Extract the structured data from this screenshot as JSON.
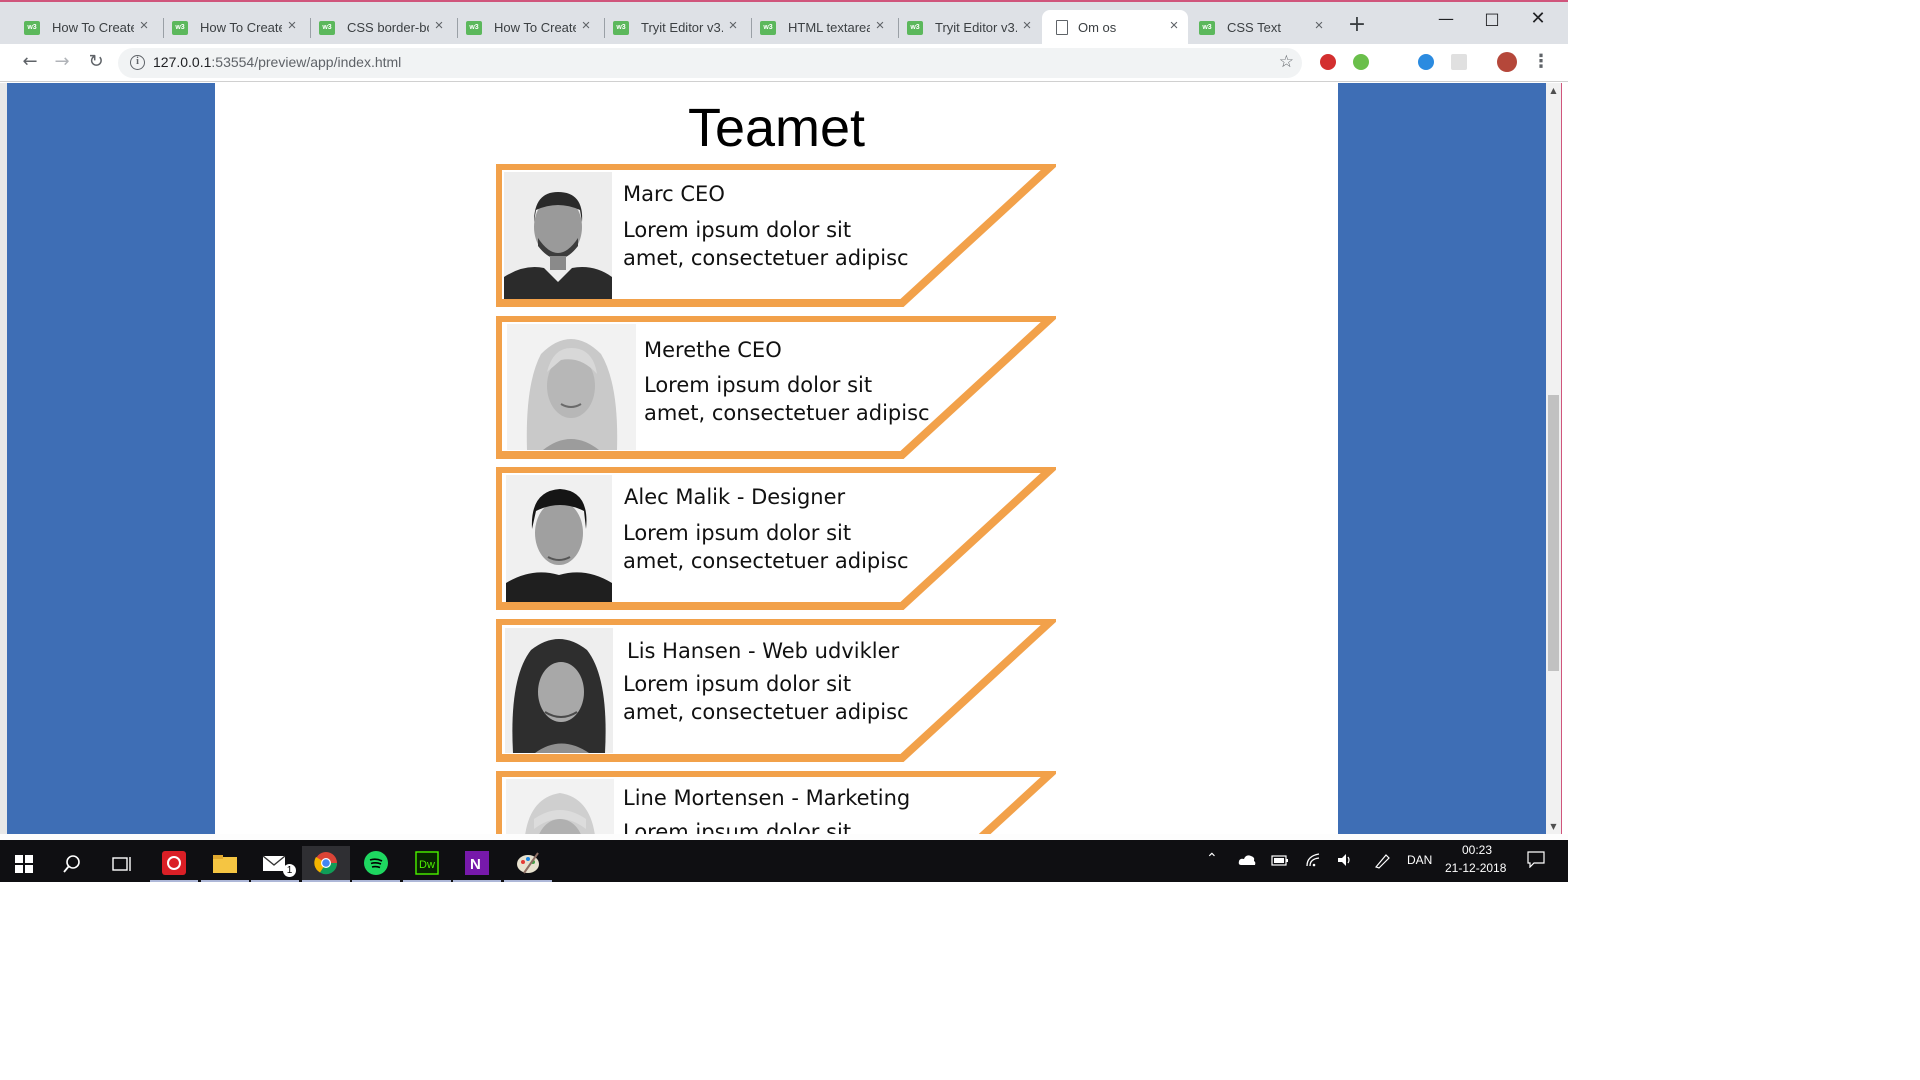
{
  "browser": {
    "tabs": [
      {
        "title": "How To Create",
        "icon": "w3-icon"
      },
      {
        "title": "How To Create",
        "icon": "w3-icon"
      },
      {
        "title": "CSS border-bo",
        "icon": "w3-icon"
      },
      {
        "title": "How To Create",
        "icon": "w3-icon"
      },
      {
        "title": "Tryit Editor v3.",
        "icon": "w3-icon"
      },
      {
        "title": "HTML textarea",
        "icon": "w3-icon"
      },
      {
        "title": "Tryit Editor v3.",
        "icon": "w3-icon"
      },
      {
        "title": "Om os",
        "icon": "document-icon",
        "active": true
      },
      {
        "title": "CSS Text",
        "icon": "w3-icon"
      }
    ],
    "url_host": "127.0.0.1",
    "url_rest": ":53554/preview/app/index.html"
  },
  "page": {
    "title": "Teamet",
    "members": [
      {
        "name": "Marc CEO",
        "desc_line1": "Lorem ipsum dolor sit",
        "desc_line2": "amet, consectetuer adipisc"
      },
      {
        "name": "Merethe CEO",
        "desc_line1": "Lorem ipsum dolor sit",
        "desc_line2": "amet, consectetuer adipisc"
      },
      {
        "name": "Alec Malik - Designer",
        "desc_line1": "Lorem ipsum dolor sit",
        "desc_line2": "amet, consectetuer adipisc"
      },
      {
        "name": "Lis Hansen - Web udvikler",
        "desc_line1": "Lorem ipsum dolor sit",
        "desc_line2": "amet, consectetuer adipisc"
      },
      {
        "name": "Line Mortensen - Marketing",
        "desc_line1": "Lorem ipsum dolor sit",
        "desc_line2": ""
      }
    ]
  },
  "taskbar": {
    "language": "DAN",
    "time": "00:23",
    "date": "21-12-2018",
    "mail_badge": "1"
  },
  "colors": {
    "page_background": "#3e6eb5",
    "card_border": "#f2a14a",
    "taskbar": "#0f0f12"
  }
}
